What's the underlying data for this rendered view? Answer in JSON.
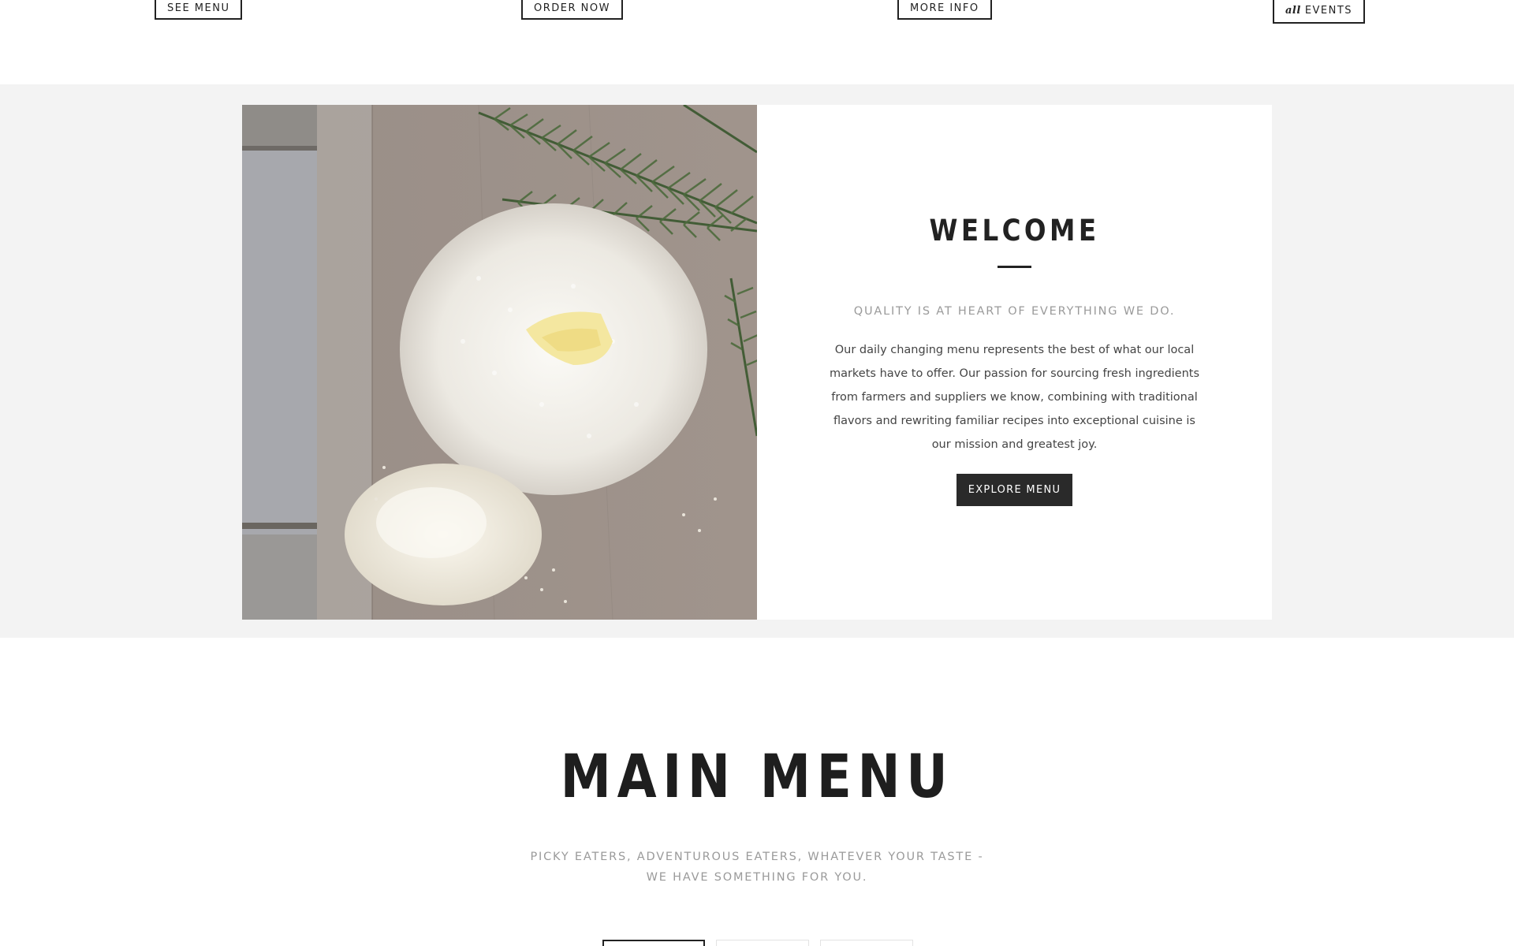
{
  "top_buttons": {
    "see_menu": "SEE MENU",
    "order_now": "ORDER NOW",
    "more_info": "MORE INFO",
    "all_events_italic": "all",
    "all_events": "EVENTS"
  },
  "welcome": {
    "photo_alt": "rice-and-rosemary-photo",
    "title": "WELCOME",
    "subtitle": "QUALITY IS AT HEART OF EVERYTHING WE DO.",
    "body": "Our daily changing menu represents the best of what our local markets have to offer. Our passion for sourcing fresh ingredients from farmers and suppliers we know, combining with traditional flavors and rewriting familiar recipes into exceptional cuisine is our mission and greatest joy.",
    "button": "EXPLORE MENU"
  },
  "main_menu": {
    "title": "MAIN MENU",
    "subtitle": "PICKY EATERS, ADVENTUROUS EATERS, WHATEVER YOUR TASTE - WE HAVE SOMETHING FOR YOU."
  },
  "colors": {
    "band_bg": "#f3f3f3",
    "dark": "#222222",
    "muted": "#9a9a9a"
  }
}
